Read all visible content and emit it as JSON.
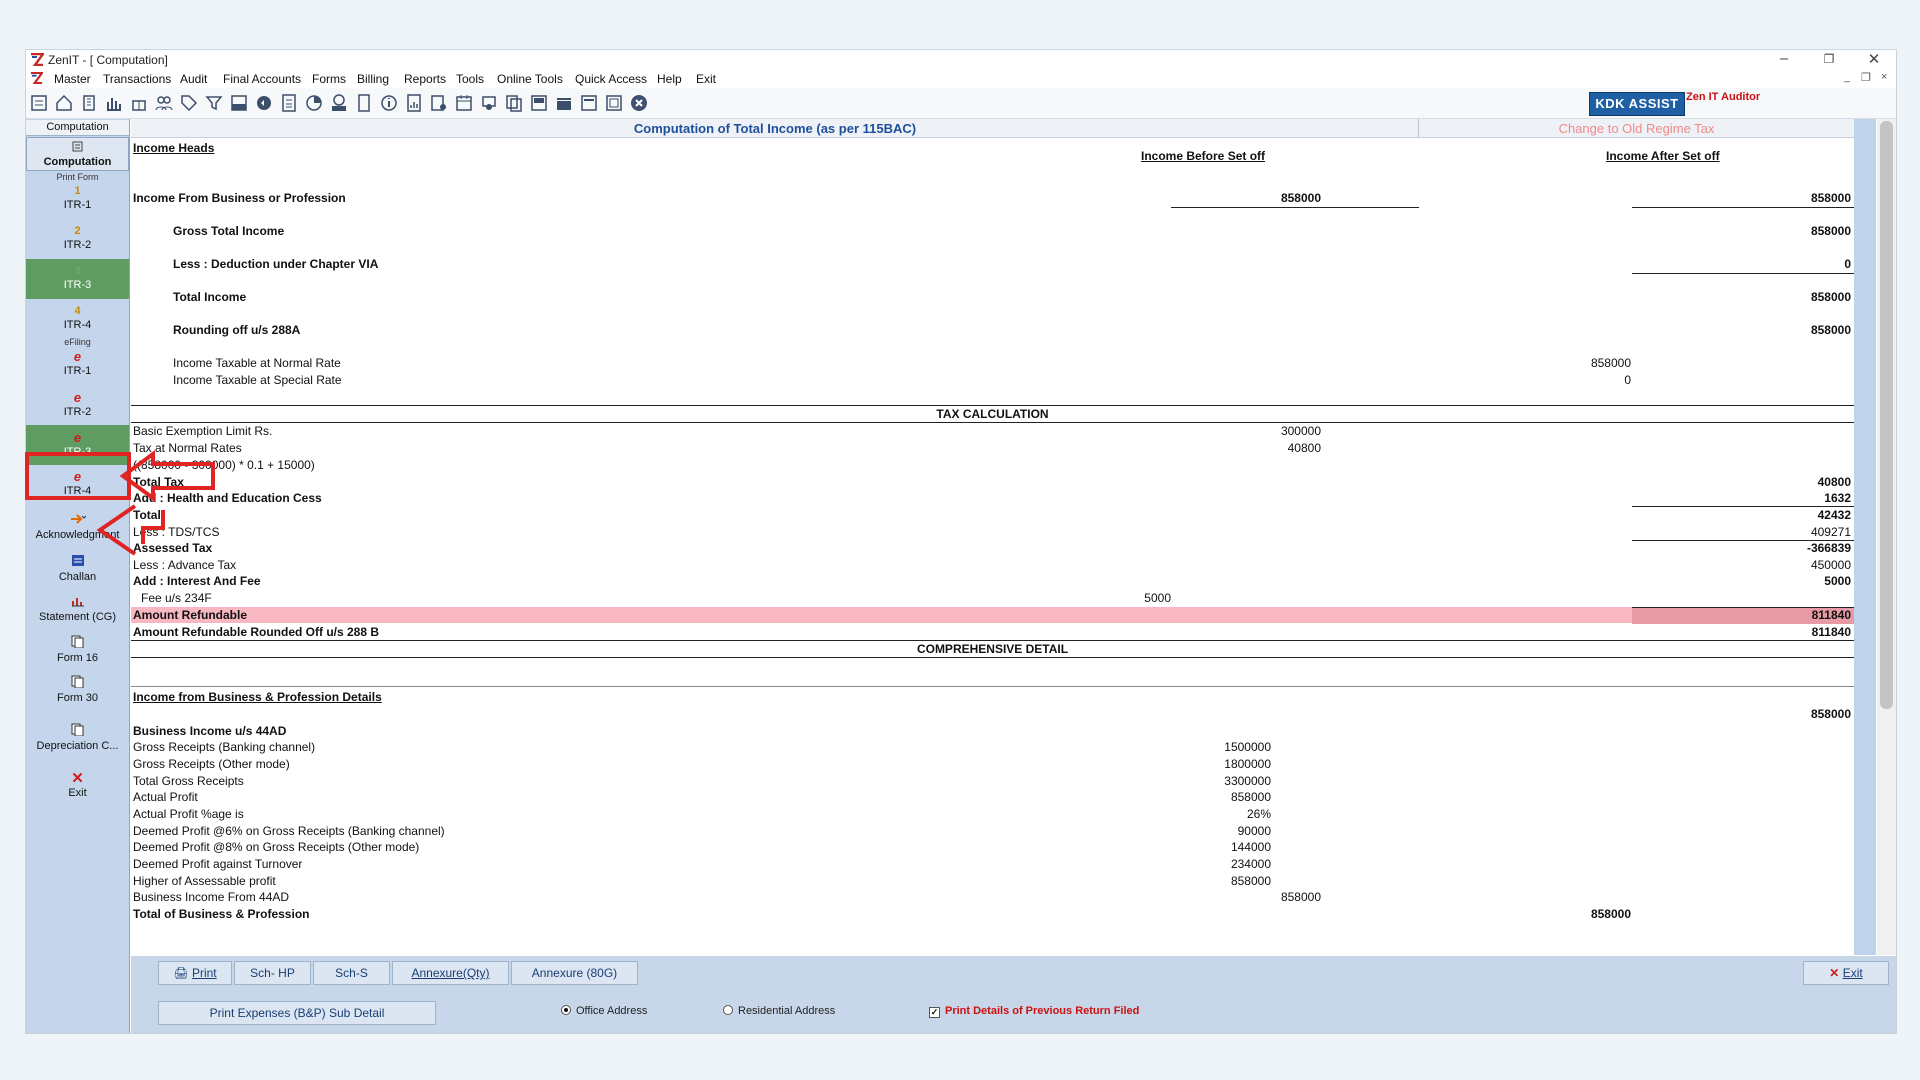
{
  "window": {
    "title": "ZenIT - [ Computation]",
    "controls": {
      "minimize": "–",
      "restore": "❐",
      "close": "✕"
    },
    "mdi_controls": {
      "minimize": "_",
      "restore": "❐",
      "close": "×"
    }
  },
  "menu": [
    "Master",
    "Transactions",
    "Audit",
    "Final Accounts",
    "Forms",
    "Billing",
    "Reports",
    "Tools",
    "Online Tools",
    "Quick Access",
    "Help",
    "Exit"
  ],
  "toolbar": {
    "kdk_assist": "KDK ASSIST",
    "zen_it_auditor": "Zen IT Auditor"
  },
  "sidebar": {
    "tab_label": "Computation",
    "computation_label": "Computation",
    "print_form_header": "Print Form",
    "print_items": [
      {
        "num": "1",
        "label": "ITR-1"
      },
      {
        "num": "2",
        "label": "ITR-2"
      },
      {
        "num": "3",
        "label": "ITR-3"
      },
      {
        "num": "4",
        "label": "ITR-4"
      }
    ],
    "efiling_header": "eFiling",
    "efiling_items": [
      {
        "label": "ITR-1"
      },
      {
        "label": "ITR-2"
      },
      {
        "label": "ITR-3"
      },
      {
        "label": "ITR-4"
      }
    ],
    "tools": [
      {
        "label": "Acknowledgment"
      },
      {
        "label": "Challan"
      },
      {
        "label": "Statement (CG)"
      },
      {
        "label": "Form 16"
      },
      {
        "label": "Form 30"
      },
      {
        "label": "Depreciation C..."
      },
      {
        "label": "Exit"
      }
    ]
  },
  "header": {
    "title": "Computation of Total Income (as per 115BAC)",
    "change_regime": "Change to Old Regime Tax"
  },
  "income_heads": {
    "heading": "Income Heads",
    "col_before": "Income Before Set off",
    "col_after": "Income After Set off",
    "business_label": "Income From Business or Profession",
    "business_before": "858000",
    "business_after": "858000",
    "gti_label": "Gross Total Income",
    "gti": "858000",
    "deduction_label": "Less : Deduction under Chapter VIA",
    "deduction": "0",
    "total_income_label": "Total Income",
    "total_income": "858000",
    "rounding_label": "Rounding off u/s 288A",
    "rounding": "858000",
    "normal_rate_label": "Income Taxable at Normal Rate",
    "normal_rate": "858000",
    "special_rate_label": "Income Taxable at Special Rate",
    "special_rate": "0"
  },
  "tax_calc": {
    "heading": "TAX CALCULATION",
    "basic_exemption_label": "Basic Exemption Limit Rs.",
    "basic_exemption": "300000",
    "tax_normal_label": "Tax at Normal Rates",
    "tax_normal": "40800",
    "formula": "((858000 - 300000) * 0.1 + 15000)",
    "total_tax_label": "Total Tax",
    "total_tax": "40800",
    "cess_label": "Add : Health and Education Cess",
    "cess": "1632",
    "total_label": "Total",
    "total": "42432",
    "tds_label": "Less : TDS/TCS",
    "tds": "409271",
    "assessed_label": "Assessed Tax",
    "assessed": "-366839",
    "advance_label": "Less : Advance Tax",
    "advance": "450000",
    "interest_label": "Add : Interest And Fee",
    "interest": "5000",
    "fee_label": "Fee u/s 234F",
    "fee": "5000",
    "refundable_label": "Amount Refundable",
    "refundable": "811840",
    "refundable_rounded_label": "Amount Refundable Rounded Off u/s 288 B",
    "refundable_rounded": "811840"
  },
  "comprehensive": {
    "heading": "COMPREHENSIVE DETAIL",
    "section_label": "Income from Business & Profession Details",
    "section_total": "858000",
    "sub_heading": "Business Income u/s 44AD",
    "rows": [
      {
        "label": "Gross Receipts (Banking channel)",
        "value": "1500000"
      },
      {
        "label": "Gross Receipts (Other mode)",
        "value": "1800000"
      },
      {
        "label": "Total Gross Receipts",
        "value": "3300000"
      },
      {
        "label": "Actual Profit",
        "value": "858000"
      },
      {
        "label": "Actual Profit %age is",
        "value": "26%"
      },
      {
        "label": "Deemed Profit @6% on Gross Receipts (Banking channel)",
        "value": "90000"
      },
      {
        "label": "Deemed Profit @8% on Gross Receipts (Other mode)",
        "value": "144000"
      },
      {
        "label": "Deemed Profit against Turnover",
        "value": "234000"
      },
      {
        "label": "Higher of Assessable profit",
        "value": "858000"
      }
    ],
    "from_44ad_label": "Business Income From 44AD",
    "from_44ad": "858000",
    "total_bp_label": "Total of Business & Profession",
    "total_bp": "858000"
  },
  "bottom": {
    "print": "Print",
    "sch_hp": "Sch- HP",
    "sch_s": "Sch-S",
    "annexure_qty": "Annexure(Qty)",
    "annexure_80g": "Annexure (80G)",
    "exit": "Exit",
    "print_expenses": "Print Expenses (B&P) Sub Detail",
    "office_address": "Office Address",
    "residential_address": "Residential Address",
    "print_prev_details": "Print Details of Previous Return Filed"
  },
  "colors": {
    "accent_blue": "#1f4f9c",
    "selected_green": "#5f9c62",
    "refund_pink": "#f7b8c2",
    "annotation_red": "#e02424"
  }
}
